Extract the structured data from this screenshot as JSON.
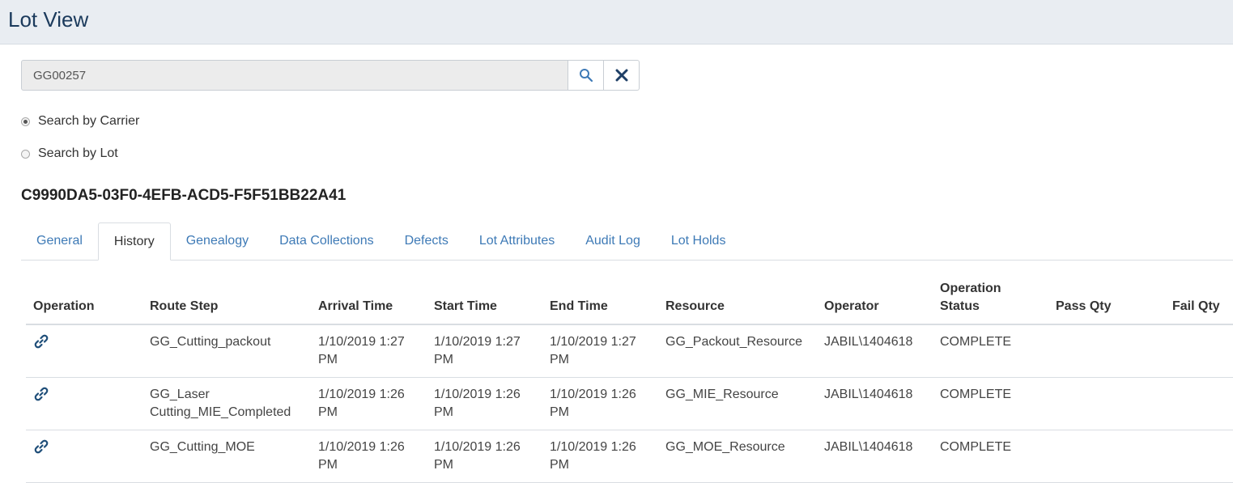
{
  "header": {
    "title": "Lot View"
  },
  "search": {
    "value": "GG00257",
    "search_icon": "search-icon",
    "clear_icon": "close-icon"
  },
  "radios": [
    {
      "label": "Search by Carrier",
      "checked": true
    },
    {
      "label": "Search by Lot",
      "checked": false
    }
  ],
  "lot": {
    "id": "C9990DA5-03F0-4EFB-ACD5-F5F51BB22A41"
  },
  "tabs": [
    {
      "label": "General",
      "active": false
    },
    {
      "label": "History",
      "active": true
    },
    {
      "label": "Genealogy",
      "active": false
    },
    {
      "label": "Data Collections",
      "active": false
    },
    {
      "label": "Defects",
      "active": false
    },
    {
      "label": "Lot Attributes",
      "active": false
    },
    {
      "label": "Audit Log",
      "active": false
    },
    {
      "label": "Lot Holds",
      "active": false
    }
  ],
  "table": {
    "columns": [
      "Operation",
      "Route Step",
      "Arrival Time",
      "Start Time",
      "End Time",
      "Resource",
      "Operator",
      "Operation Status",
      "Pass Qty",
      "Fail Qty"
    ],
    "rows": [
      {
        "operation_icon": "link-icon",
        "route_step": "GG_Cutting_packout",
        "arrival_time": "1/10/2019 1:27 PM",
        "start_time": "1/10/2019 1:27 PM",
        "end_time": "1/10/2019 1:27 PM",
        "resource": "GG_Packout_Resource",
        "operator": "JABIL\\1404618",
        "status": "COMPLETE",
        "pass_qty": "",
        "fail_qty": ""
      },
      {
        "operation_icon": "link-icon",
        "route_step": "GG_Laser Cutting_MIE_Completed",
        "arrival_time": "1/10/2019 1:26 PM",
        "start_time": "1/10/2019 1:26 PM",
        "end_time": "1/10/2019 1:26 PM",
        "resource": "GG_MIE_Resource",
        "operator": "JABIL\\1404618",
        "status": "COMPLETE",
        "pass_qty": "",
        "fail_qty": ""
      },
      {
        "operation_icon": "link-icon",
        "route_step": "GG_Cutting_MOE",
        "arrival_time": "1/10/2019 1:26 PM",
        "start_time": "1/10/2019 1:26 PM",
        "end_time": "1/10/2019 1:26 PM",
        "resource": "GG_MOE_Resource",
        "operator": "JABIL\\1404618",
        "status": "COMPLETE",
        "pass_qty": "",
        "fail_qty": ""
      }
    ]
  },
  "colors": {
    "link": "#3e7ab6",
    "title": "#1b3a5c",
    "icon": "#1f4e79"
  }
}
